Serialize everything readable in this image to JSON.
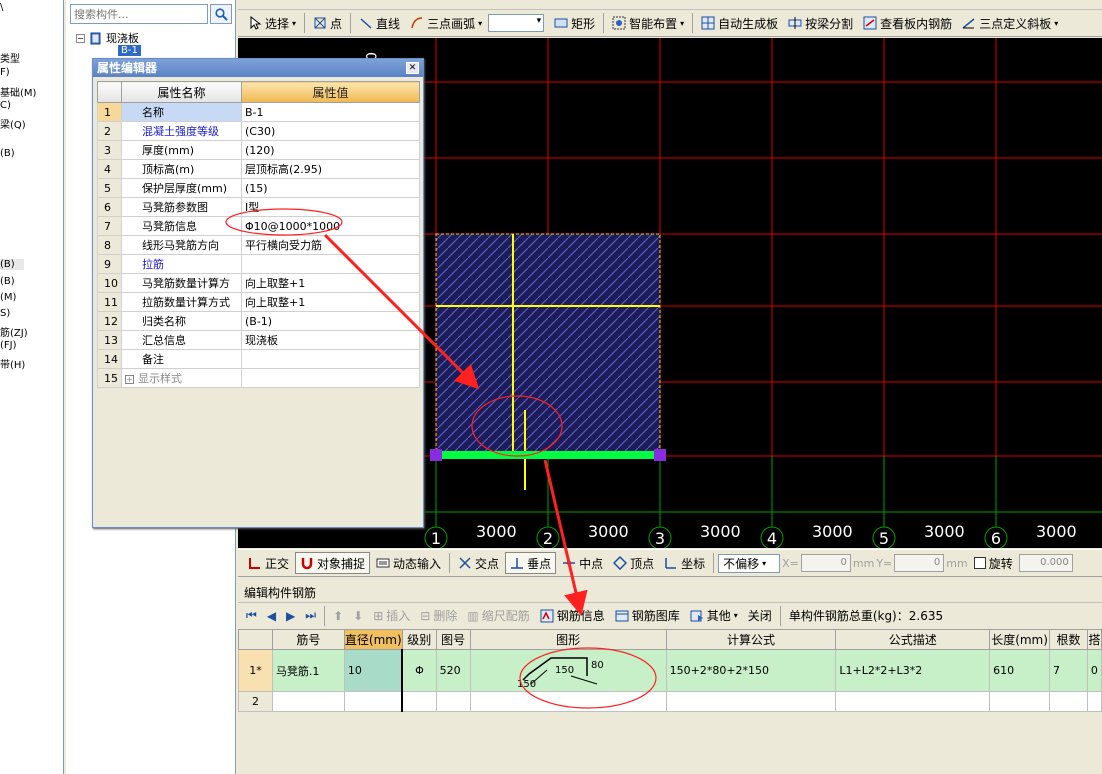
{
  "left_strip": {
    "items": [
      "\\",
      "类型",
      "F)",
      "基础(M)",
      "C)",
      "梁(Q)",
      "(B)",
      "(B)",
      "(B)",
      "(M)",
      "S)",
      "筋(ZJ)",
      "(FJ)",
      "带(H)"
    ]
  },
  "tree": {
    "search_placeholder": "搜索构件...",
    "root_label": "现浇板",
    "child_label": "B-1"
  },
  "toolbar": {
    "select_label": "选择",
    "point_label": "点",
    "line_label": "直线",
    "arc_label": "三点画弧",
    "rect_label": "矩形",
    "smart_label": "智能布置",
    "auto_label": "自动生成板",
    "split_label": "按梁分割",
    "view_label": "查看板内钢筋",
    "slope_label": "三点定义斜板"
  },
  "property_editor": {
    "title": "属性编辑器",
    "col_name": "属性名称",
    "col_value": "属性值",
    "rows": [
      {
        "idx": "1",
        "name": "名称",
        "value": "B-1"
      },
      {
        "idx": "2",
        "name": "混凝土强度等级",
        "value": "(C30)"
      },
      {
        "idx": "3",
        "name": "厚度(mm)",
        "value": "(120)"
      },
      {
        "idx": "4",
        "name": "顶标高(m)",
        "value": "层顶标高(2.95)"
      },
      {
        "idx": "5",
        "name": "保护层厚度(mm)",
        "value": "(15)"
      },
      {
        "idx": "6",
        "name": "马凳筋参数图",
        "value": "Ⅰ型"
      },
      {
        "idx": "7",
        "name": "马凳筋信息",
        "value": "Φ10@1000*1000"
      },
      {
        "idx": "8",
        "name": "线形马凳筋方向",
        "value": "平行横向受力筋"
      },
      {
        "idx": "9",
        "name": "拉筋",
        "value": ""
      },
      {
        "idx": "10",
        "name": "马凳筋数量计算方",
        "value": "向上取整+1"
      },
      {
        "idx": "11",
        "name": "拉筋数量计算方式",
        "value": "向上取整+1"
      },
      {
        "idx": "12",
        "name": "归类名称",
        "value": "(B-1)"
      },
      {
        "idx": "13",
        "name": "汇总信息",
        "value": "现浇板"
      },
      {
        "idx": "14",
        "name": "备注",
        "value": ""
      },
      {
        "idx": "15",
        "name": "显示样式",
        "value": ""
      }
    ]
  },
  "canvas": {
    "top_label": "00",
    "axis_numbers": [
      "1",
      "2",
      "3",
      "4",
      "5",
      "6"
    ],
    "spacing_label": "3000"
  },
  "snap_bar": {
    "ortho": "正交",
    "snap": "对象捕捉",
    "dynamic": "动态输入",
    "intersect": "交点",
    "perp": "垂点",
    "mid": "中点",
    "vertex": "顶点",
    "coord": "坐标",
    "offset_mode": "不偏移",
    "x_label": "X=",
    "x_value": "0",
    "y_label": "Y=",
    "y_value": "0",
    "unit": "mm",
    "rotate": "旋转",
    "rotate_value": "0.000"
  },
  "bottom_panel": {
    "title": "编辑构件钢筋",
    "insert": "插入",
    "delete": "删除",
    "scale": "缩尺配筋",
    "rebar_info": "钢筋信息",
    "rebar_lib": "钢筋图库",
    "other": "其他",
    "close": "关闭",
    "total_weight": "单构件钢筋总重(kg)：2.635",
    "columns": [
      "筋号",
      "直径(mm)",
      "级别",
      "图号",
      "图形",
      "计算公式",
      "公式描述",
      "长度(mm)",
      "根数",
      "搭"
    ],
    "rows": [
      {
        "num": "1*",
        "name": "马凳筋.1",
        "diameter": "10",
        "grade": "Φ",
        "fig": "520",
        "formula": "150+2*80+2*150",
        "desc": "L1+L2*2+L3*2",
        "length": "610",
        "count": "7",
        "lap": "0"
      },
      {
        "num": "2",
        "name": "",
        "diameter": "",
        "grade": "",
        "fig": "",
        "formula": "",
        "desc": "",
        "length": "",
        "count": "",
        "lap": ""
      }
    ],
    "shape_labels": {
      "top": "150",
      "side": "80",
      "foot": "150"
    }
  },
  "colors": {
    "canvas_bg": "#000000",
    "grid_red": "#e00000",
    "grid_green": "#00a000",
    "slab_blue": "#3a3a9a",
    "rebar_yellow": "#ffff00",
    "beam_green": "#00ff40",
    "annotation_red": "#ff2020"
  }
}
